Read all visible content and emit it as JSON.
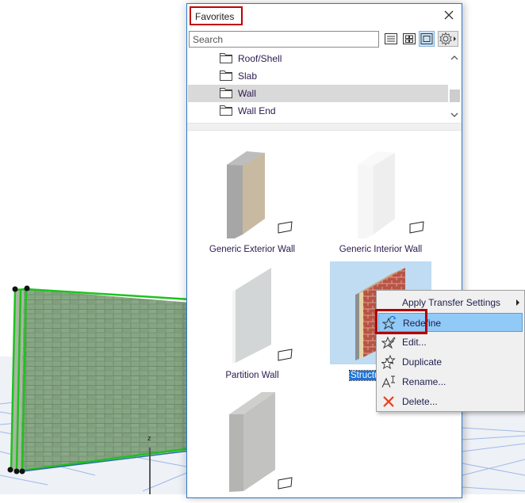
{
  "palette": {
    "title": "Favorites",
    "search_placeholder": "Search",
    "view_modes": [
      {
        "name": "list-view",
        "active": false
      },
      {
        "name": "icon-view",
        "active": false
      },
      {
        "name": "preview-view",
        "active": true
      }
    ],
    "tree_items": [
      {
        "label": "Roof/Shell",
        "selected": false
      },
      {
        "label": "Slab",
        "selected": false
      },
      {
        "label": "Wall",
        "selected": true
      },
      {
        "label": "Wall End",
        "selected": false
      }
    ],
    "favorites": [
      {
        "label": "Generic Exterior Wall",
        "selected": false
      },
      {
        "label": "Generic Interior Wall",
        "selected": false
      },
      {
        "label": "Partition Wall",
        "selected": false
      },
      {
        "label": "Structu",
        "selected": true
      },
      {
        "label": "",
        "selected": false
      }
    ]
  },
  "context_menu": {
    "items": [
      {
        "label": "Apply Transfer Settings",
        "icon": "none",
        "submenu": true
      },
      {
        "label": "Redefine",
        "icon": "redefine-star-icon",
        "highlighted": true
      },
      {
        "label": "Edit...",
        "icon": "edit-star-icon"
      },
      {
        "label": "Duplicate",
        "icon": "duplicate-star-icon"
      },
      {
        "label": "Rename...",
        "icon": "rename-icon"
      },
      {
        "label": "Delete...",
        "icon": "delete-x-icon"
      }
    ]
  },
  "viewport": {
    "axis_label": "z"
  },
  "colors": {
    "accent_blue": "#2a7ad2",
    "highlight_red": "#c00000",
    "selection_green": "#22bb22",
    "menu_highlight": "#91c9f7",
    "delete_red": "#e8401c"
  }
}
